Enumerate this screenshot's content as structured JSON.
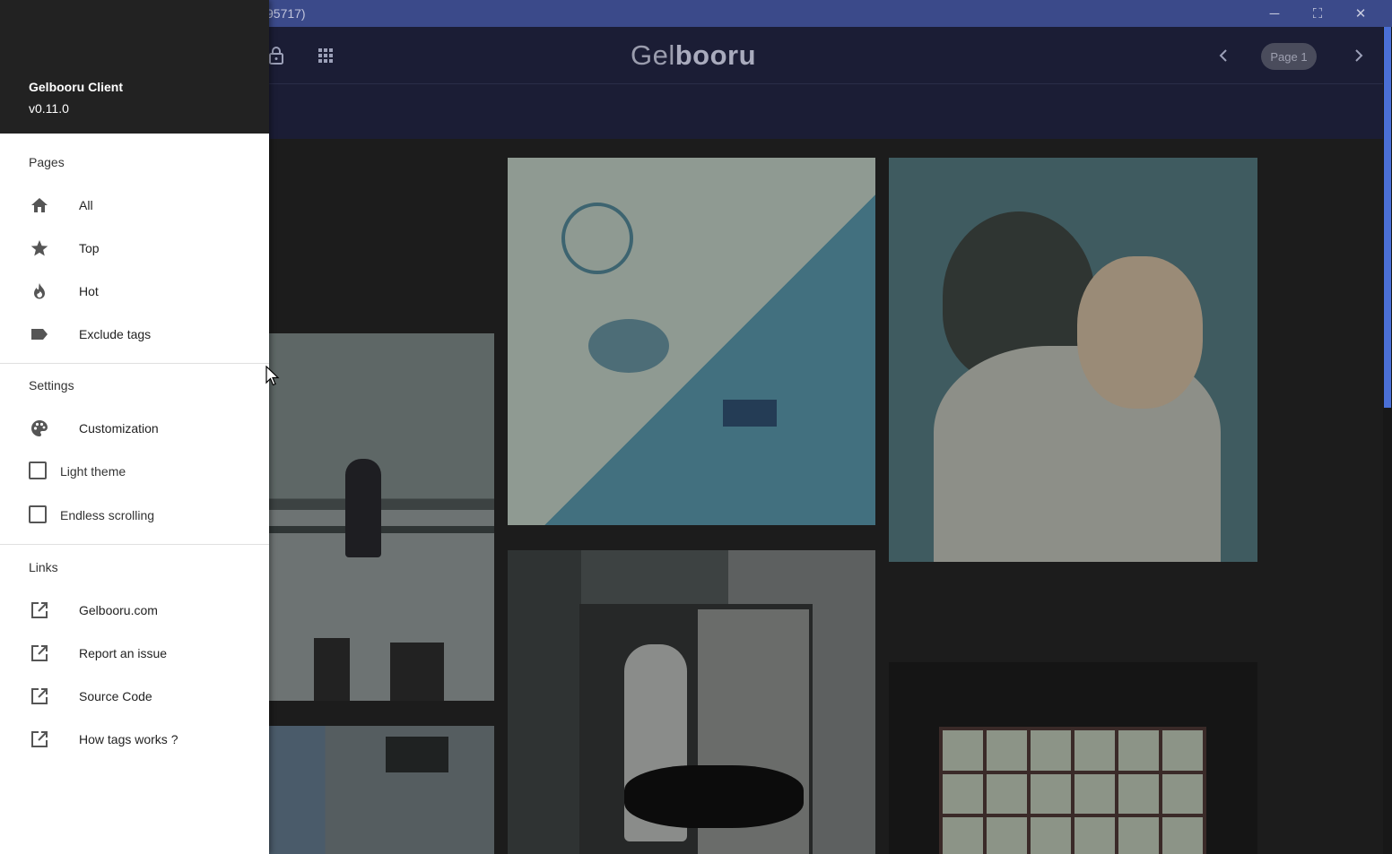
{
  "window": {
    "title_fragment": "95717)",
    "controls": {
      "minimize": "─",
      "maximize": "⛶",
      "close": "✕"
    }
  },
  "header": {
    "logo_light": "Gel",
    "logo_bold": "booru",
    "page_label": "Page 1",
    "icons": [
      "lock-icon",
      "grid-icon",
      "chevron-left-icon",
      "chevron-right-icon"
    ]
  },
  "drawer": {
    "app_name": "Gelbooru Client",
    "version": "v0.11.0",
    "pages": {
      "title": "Pages",
      "items": [
        {
          "label": "All",
          "icon": "home-icon"
        },
        {
          "label": "Top",
          "icon": "star-icon"
        },
        {
          "label": "Hot",
          "icon": "fire-icon"
        },
        {
          "label": "Exclude tags",
          "icon": "label-icon"
        }
      ]
    },
    "settings": {
      "title": "Settings",
      "customization": {
        "label": "Customization",
        "icon": "palette-icon"
      },
      "light_theme": {
        "label": "Light theme",
        "checked": false
      },
      "endless_scrolling": {
        "label": "Endless scrolling",
        "checked": false
      }
    },
    "links": {
      "title": "Links",
      "items": [
        {
          "label": "Gelbooru.com",
          "icon": "external-link-icon"
        },
        {
          "label": "Report an issue",
          "icon": "external-link-icon"
        },
        {
          "label": "Source Code",
          "icon": "external-link-icon"
        },
        {
          "label": "How tags works ?",
          "icon": "external-link-icon"
        }
      ]
    }
  },
  "colors": {
    "titlebar": "#3b4a8a",
    "appbar": "#1b1d35",
    "drawer_header": "#222222",
    "scroll_thumb": "#4a6fd6"
  }
}
